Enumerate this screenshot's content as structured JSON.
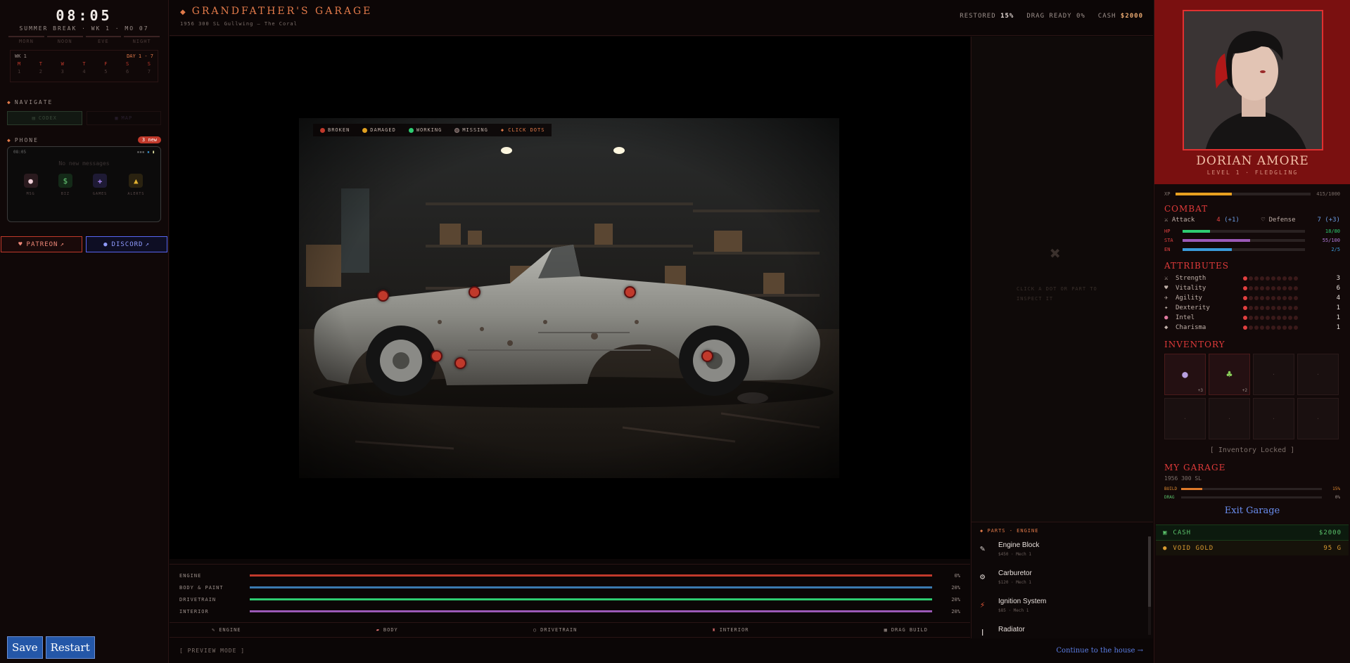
{
  "clock": {
    "time": "08:05",
    "subtitle": "SUMMER BREAK · WK 1 · MO 07",
    "periods": [
      "MORN",
      "NOON",
      "EVE",
      "NIGHT"
    ]
  },
  "calendar": {
    "week": "WK 1",
    "range": "DAY 1 - 7",
    "days": [
      "M",
      "T",
      "W",
      "T",
      "F",
      "S",
      "S"
    ],
    "nums": [
      "1",
      "2",
      "3",
      "4",
      "5",
      "6",
      "7"
    ]
  },
  "navigate": {
    "title": "NAVIGATE",
    "codex": "CODEX",
    "map": "MAP"
  },
  "phone": {
    "title": "PHONE",
    "badge": "3 new",
    "time": "08:05",
    "empty": "No new messages",
    "apps": [
      "MSG",
      "BIZ",
      "GAMES",
      "ALERTS"
    ]
  },
  "social": {
    "patreon": "PATREON",
    "discord": "DISCORD"
  },
  "system": {
    "save": "Save",
    "restart": "Restart"
  },
  "header": {
    "title": "GRANDFATHER'S GARAGE",
    "subtitle": "1956 300 SL Gullwing — The Coral"
  },
  "stats": {
    "restored_label": "RESTORED",
    "restored": "15%",
    "drag_label": "DRAG READY",
    "drag": "0%",
    "cash_label": "CASH",
    "cash": "$2000"
  },
  "legend": {
    "broken": "BROKEN",
    "damaged": "DAMAGED",
    "working": "WORKING",
    "missing": "MISSING",
    "click": "CLICK DOTS"
  },
  "colors": {
    "broken": "#c0392b",
    "damaged": "#e0a020",
    "working": "#2ecc71",
    "missing": "#5a4a48",
    "accent": "#e27a4a"
  },
  "progress": [
    {
      "label": "ENGINE",
      "value": "0%",
      "fraction": 0.0,
      "color": "#c0392b"
    },
    {
      "label": "BODY & PAINT",
      "value": "20%",
      "fraction": 0.2,
      "color": "#3a7ab0"
    },
    {
      "label": "DRIVETRAIN",
      "value": "20%",
      "fraction": 0.2,
      "color": "#2ecc71"
    },
    {
      "label": "INTERIOR",
      "value": "20%",
      "fraction": 0.2,
      "color": "#9b59b6"
    }
  ],
  "tabs": {
    "engine": "ENGINE",
    "body": "BODY",
    "drivetrain": "DRIVETRAIN",
    "interior": "INTERIOR",
    "drag": "DRAG BUILD"
  },
  "bottom": {
    "preview": "[ PREVIEW MODE ]",
    "continue": "Continue to the house →"
  },
  "inspector": {
    "hint": "CLICK A DOT OR PART TO INSPECT IT"
  },
  "parts": {
    "title": "PARTS - ENGINE",
    "items": [
      {
        "name": "Engine Block",
        "meta": "$450 · Mech 1",
        "icon": "wrench-icon"
      },
      {
        "name": "Carburetor",
        "meta": "$120 · Mech 1",
        "icon": "gear-icon"
      },
      {
        "name": "Ignition System",
        "meta": "$85 · Mech 1",
        "icon": "bolt-icon"
      },
      {
        "name": "Radiator",
        "meta": "",
        "icon": "thermometer-icon"
      }
    ]
  },
  "hero": {
    "name": "DORIAN AMORE",
    "level": "LEVEL 1 · FLEDGLING",
    "xp_label": "XP",
    "xp": "415/1000",
    "xp_fraction": 0.415
  },
  "combat": {
    "title": "COMBAT",
    "attack_label": "Attack",
    "attack": "4",
    "attack_bonus": "(+1)",
    "defense_label": "Defense",
    "defense": "7",
    "defense_bonus": "(+3)",
    "bars": [
      {
        "key": "HP",
        "value": "18/80",
        "fraction": 0.225,
        "color": "#2ecc71"
      },
      {
        "key": "STA",
        "value": "55/100",
        "fraction": 0.55,
        "color": "#9b59b6"
      },
      {
        "key": "EN",
        "value": "2/5",
        "fraction": 0.4,
        "color": "#3a9ad9"
      }
    ]
  },
  "attributes": {
    "title": "ATTRIBUTES",
    "items": [
      {
        "icon": "⚔",
        "name": "Strength",
        "value": "3",
        "level": 3
      },
      {
        "icon": "♥",
        "name": "Vitality",
        "value": "6",
        "level": 6
      },
      {
        "icon": "✈",
        "name": "Agility",
        "value": "4",
        "level": 4
      },
      {
        "icon": "✦",
        "name": "Dexterity",
        "value": "1",
        "level": 1
      },
      {
        "icon": "●",
        "name": "Intel",
        "value": "1",
        "level": 1
      },
      {
        "icon": "◆",
        "name": "Charisma",
        "value": "1",
        "level": 1
      }
    ]
  },
  "inventory": {
    "title": "INVENTORY",
    "slot1_count": "+3",
    "slot2_count": "+2",
    "empty": "·",
    "locked": "[ Inventory Locked ]"
  },
  "garage": {
    "title": "MY GARAGE",
    "car": "1956 300 SL",
    "build_label": "BUILD",
    "build": "15%",
    "build_fraction": 0.15,
    "drag_label": "DRAG",
    "drag": "0%",
    "drag_fraction": 0.0,
    "exit": "Exit Garage"
  },
  "wallet": {
    "cash_label": "CASH",
    "cash": "$2000",
    "gold_label": "VOID GOLD",
    "gold": "95 G"
  }
}
